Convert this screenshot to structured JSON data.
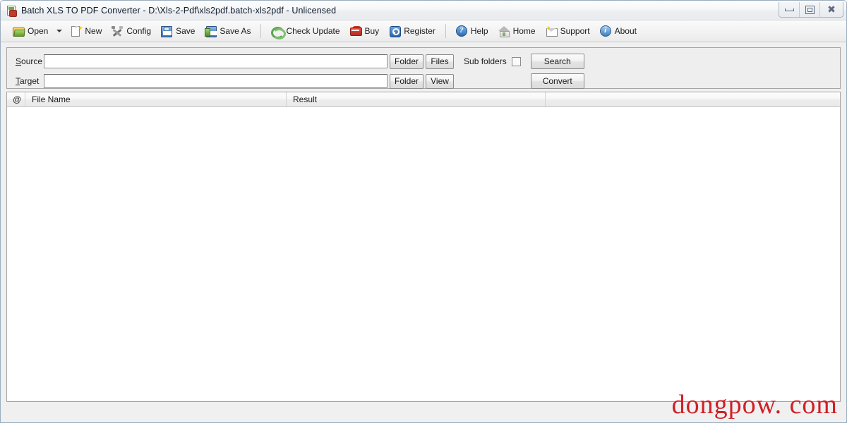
{
  "window": {
    "title": "Batch XLS TO PDF Converter - D:\\Xls-2-Pdf\\xls2pdf.batch-xls2pdf - Unlicensed",
    "app_icon": "app-icon",
    "controls": {
      "minimize": "minimize-icon",
      "maximize": "maximize-icon",
      "close": "close-icon"
    }
  },
  "toolbar": {
    "items": [
      {
        "label": "Open",
        "icon": "open-folder-icon",
        "has_dropdown": true
      },
      {
        "label": "New",
        "icon": "new-document-icon",
        "has_dropdown": false
      },
      {
        "label": "Config",
        "icon": "tools-icon",
        "has_dropdown": false
      },
      {
        "label": "Save",
        "icon": "floppy-disk-icon",
        "has_dropdown": false
      },
      {
        "label": "Save As",
        "icon": "floppy-disk-green-icon",
        "has_dropdown": false
      },
      {
        "label": "Check Update",
        "icon": "refresh-arrows-icon",
        "has_dropdown": false
      },
      {
        "label": "Buy",
        "icon": "shopping-cart-icon",
        "has_dropdown": false
      },
      {
        "label": "Register",
        "icon": "key-badge-icon",
        "has_dropdown": false
      },
      {
        "label": "Help",
        "icon": "question-circle-icon",
        "has_dropdown": false
      },
      {
        "label": "Home",
        "icon": "house-icon",
        "has_dropdown": false
      },
      {
        "label": "Support",
        "icon": "envelope-icon",
        "has_dropdown": false
      },
      {
        "label": "About",
        "icon": "info-circle-icon",
        "has_dropdown": false
      }
    ]
  },
  "paths": {
    "source": {
      "label": "Source",
      "accel": "S",
      "rest": "ource",
      "value": "",
      "placeholder": "",
      "folder_button": "Folder",
      "files_button": "Files"
    },
    "target": {
      "label": "Target",
      "accel": "T",
      "rest": "arget",
      "value": "",
      "placeholder": "",
      "folder_button": "Folder",
      "view_button": "View"
    },
    "sub_folders": {
      "label": "Sub folders",
      "checked": false
    },
    "search_button": "Search",
    "convert_button": "Convert"
  },
  "file_list": {
    "columns": [
      "@",
      "File Name",
      "Result",
      ""
    ],
    "rows": []
  },
  "watermark": {
    "text": "dongpow. com",
    "color": "#cf2026"
  }
}
